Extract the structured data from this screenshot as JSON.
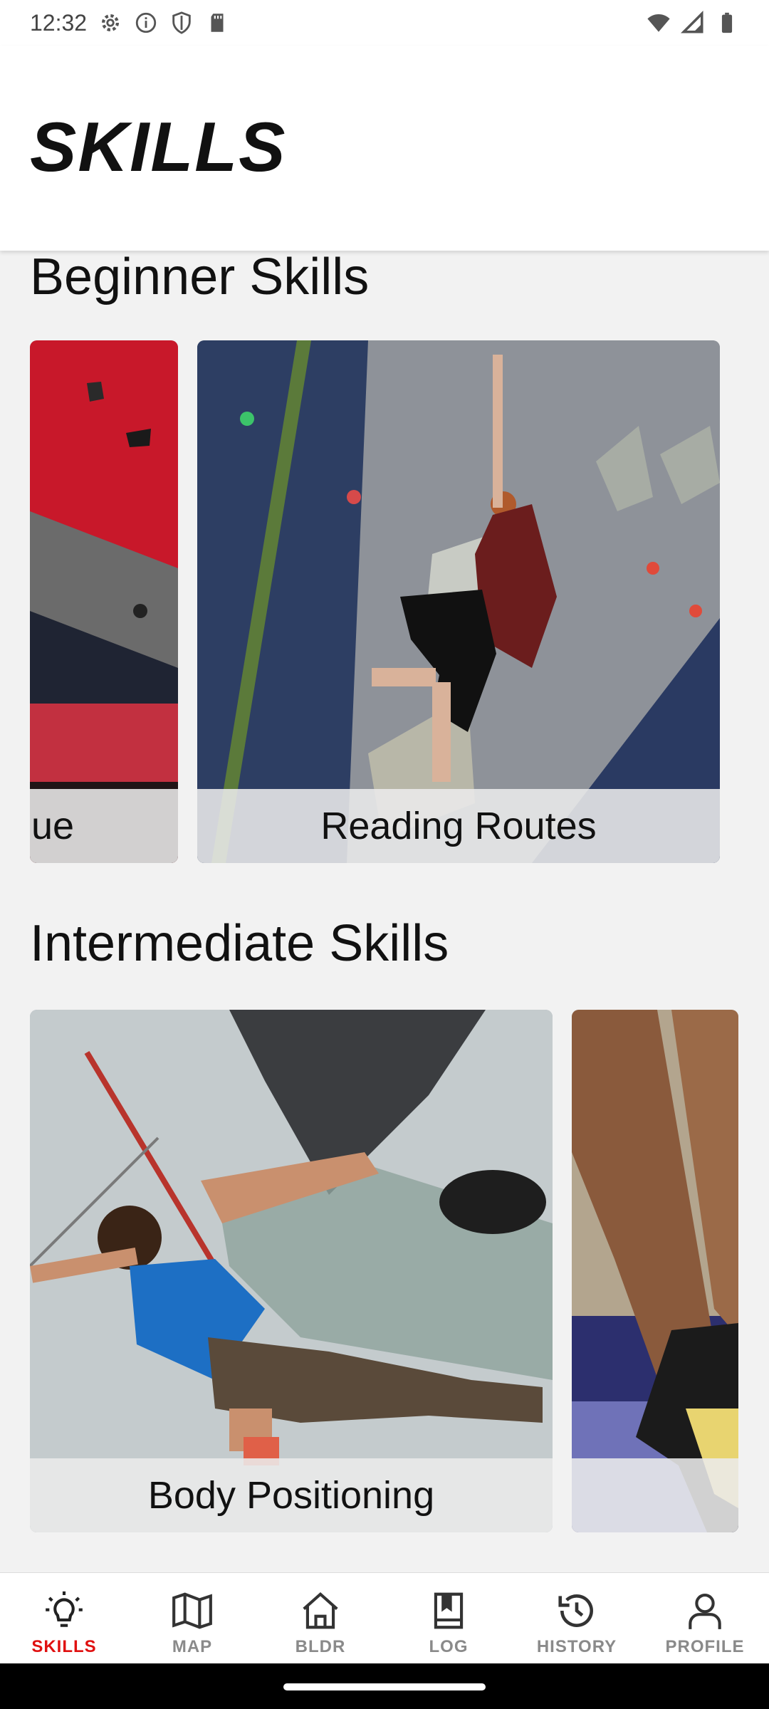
{
  "status_bar": {
    "time": "12:32",
    "icons_left": [
      "gear-icon",
      "info-icon",
      "shield-icon",
      "sd-card-icon"
    ],
    "icons_right": [
      "wifi-icon",
      "signal-icon",
      "battery-icon"
    ]
  },
  "header": {
    "title": "SKILLS"
  },
  "sections": [
    {
      "title": "Beginner Skills",
      "cards": [
        {
          "label": "ue"
        },
        {
          "label": "Reading Routes"
        }
      ]
    },
    {
      "title": "Intermediate Skills",
      "cards": [
        {
          "label": "Body Positioning"
        },
        {
          "label": ""
        }
      ]
    }
  ],
  "nav": {
    "items": [
      {
        "label": "SKILLS",
        "icon": "lightbulb-icon",
        "active": true
      },
      {
        "label": "MAP",
        "icon": "map-icon",
        "active": false
      },
      {
        "label": "BLDR",
        "icon": "home-icon",
        "active": false
      },
      {
        "label": "LOG",
        "icon": "book-icon",
        "active": false
      },
      {
        "label": "HISTORY",
        "icon": "history-icon",
        "active": false
      },
      {
        "label": "PROFILE",
        "icon": "person-icon",
        "active": false
      }
    ]
  },
  "colors": {
    "accent": "#e01010",
    "inactive": "#8a8a8a",
    "background": "#f2f2f2"
  }
}
